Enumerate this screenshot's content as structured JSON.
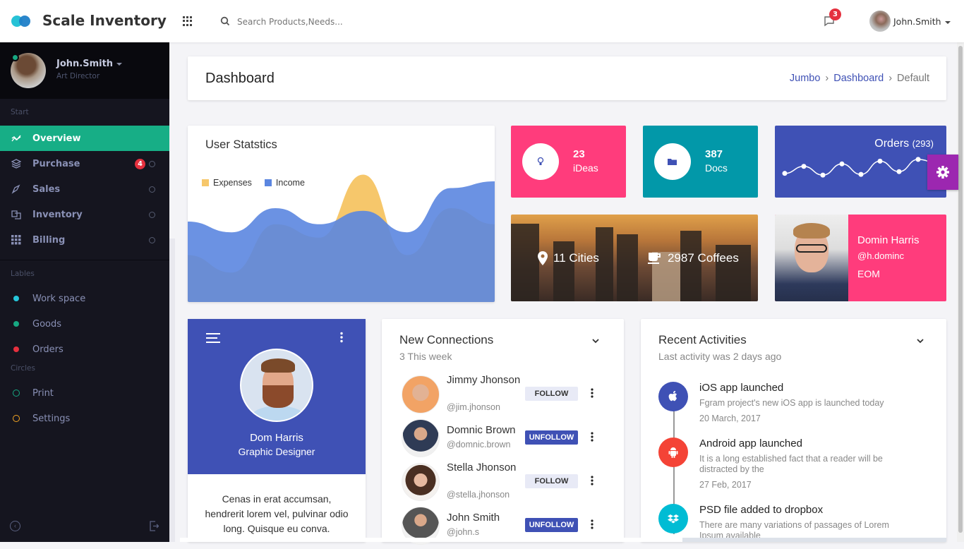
{
  "topbar": {
    "brand": "Scale Inventory",
    "search_placeholder": "Search Products,Needs...",
    "messages_badge": "3",
    "user_name": "John.Smith"
  },
  "sidebar": {
    "user": {
      "name": "John.Smith",
      "role": "Art Director",
      "status": "online"
    },
    "sections": {
      "start": "Start",
      "labels": "Lables",
      "circles": "Circles"
    },
    "nav": [
      {
        "label": "Overview",
        "icon": "chart-line-icon",
        "active": true
      },
      {
        "label": "Purchase",
        "icon": "layers-icon",
        "badge": "4"
      },
      {
        "label": "Sales",
        "icon": "rocket-icon"
      },
      {
        "label": "Inventory",
        "icon": "cards-icon"
      },
      {
        "label": "Billing",
        "icon": "grid-icon"
      }
    ],
    "labels": [
      {
        "label": "Work space",
        "color": "#26c6da"
      },
      {
        "label": "Goods",
        "color": "#17a882"
      },
      {
        "label": "Orders",
        "color": "#e5303e"
      }
    ],
    "circles": [
      {
        "label": "Print",
        "color": "#17a882"
      },
      {
        "label": "Settings",
        "color": "#f6a623"
      }
    ]
  },
  "page_header": {
    "title": "Dashboard",
    "breadcrumb": [
      "Jumbo",
      "Dashboard",
      "Default"
    ]
  },
  "user_statistics": {
    "title": "User Statstics",
    "chart_data": {
      "type": "area",
      "title": "User Statstics",
      "x": [
        0,
        1,
        2,
        3,
        4,
        5,
        6,
        7
      ],
      "series": [
        {
          "name": "Expenses",
          "color": "#f6c76b",
          "values": [
            35,
            22,
            58,
            48,
            95,
            35,
            70,
            58
          ]
        },
        {
          "name": "Income",
          "color": "#5b86e0",
          "values": [
            60,
            52,
            70,
            58,
            68,
            52,
            85,
            90
          ]
        }
      ],
      "ylim": [
        0,
        100
      ],
      "legend": "top-left",
      "grid": false
    }
  },
  "tiles": {
    "ideas": {
      "value": "23",
      "label": "iDeas",
      "icon": "lightbulb-icon",
      "color": "#ff3c7c"
    },
    "docs": {
      "value": "387",
      "label": "Docs",
      "icon": "folder-icon",
      "color": "#0298a9"
    },
    "orders": {
      "title": "Orders",
      "count": "(293)",
      "color": "#3f51b5",
      "sparkline": [
        35,
        55,
        30,
        62,
        32,
        70,
        40,
        75,
        65
      ]
    },
    "city": {
      "cities": "11 Cities",
      "coffees": "2987 Coffees"
    },
    "profile": {
      "name": "Domin Harris",
      "handle": "@h.dominc",
      "role": "EOM"
    }
  },
  "dom_card": {
    "name": "Dom Harris",
    "title": "Graphic Designer",
    "description": "Cenas in erat accumsan, hendrerit lorem vel, pulvinar odio long. Quisque eu conva."
  },
  "connections": {
    "title": "New Connections",
    "subtitle": "3 This week",
    "items": [
      {
        "name": "Jimmy Jhonson",
        "handle": "@jim.jhonson",
        "action": "FOLLOW"
      },
      {
        "name": "Domnic Brown",
        "handle": "@domnic.brown",
        "action": "UNFOLLOW"
      },
      {
        "name": "Stella Jhonson",
        "handle": "@stella.jhonson",
        "action": "FOLLOW"
      },
      {
        "name": "John Smith",
        "handle": "@john.s",
        "action": "UNFOLLOW"
      }
    ]
  },
  "activities": {
    "title": "Recent Activities",
    "subtitle": "Last activity was 2 days ago",
    "items": [
      {
        "title": "iOS app launched",
        "desc": "Fgram project's new iOS app is launched today",
        "date": "20 March, 2017",
        "icon": "apple-icon",
        "color": "#3f51b5"
      },
      {
        "title": "Android app launched",
        "desc": "It is a long established fact that a reader will be distracted by the",
        "date": "27 Feb, 2017",
        "icon": "android-icon",
        "color": "#f44336"
      },
      {
        "title": "PSD file added to dropbox",
        "desc": "There are many variations of passages of Lorem Ipsum available",
        "date": "",
        "icon": "dropbox-icon",
        "color": "#00bcd4"
      }
    ]
  }
}
